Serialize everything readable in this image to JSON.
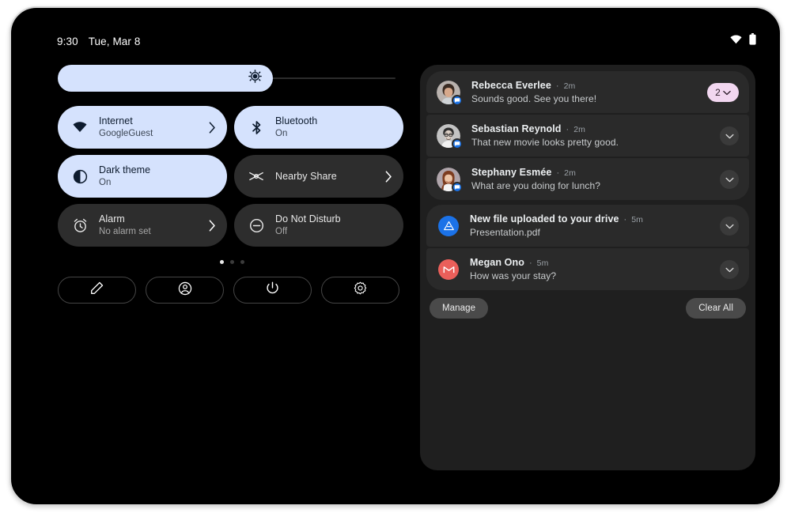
{
  "statusbar": {
    "time": "9:30",
    "date": "Tue, Mar 8",
    "icons": [
      "wifi-icon",
      "battery-icon"
    ]
  },
  "quick_settings": {
    "brightness": {
      "icon": "brightness-sun-icon",
      "level_percent": 62
    },
    "tiles": [
      {
        "title": "Internet",
        "subtitle": "GoogleGuest",
        "icon": "wifi-icon",
        "state": "on",
        "chevron": true
      },
      {
        "title": "Bluetooth",
        "subtitle": "On",
        "icon": "bluetooth-icon",
        "state": "on",
        "chevron": false
      },
      {
        "title": "Dark theme",
        "subtitle": "On",
        "icon": "dark-theme-icon",
        "state": "on",
        "chevron": false
      },
      {
        "title": "Nearby Share",
        "subtitle": "",
        "icon": "nearby-share-icon",
        "state": "off",
        "chevron": true
      },
      {
        "title": "Alarm",
        "subtitle": "No alarm set",
        "icon": "alarm-icon",
        "state": "off",
        "chevron": true
      },
      {
        "title": "Do Not Disturb",
        "subtitle": "Off",
        "icon": "do-not-disturb-icon",
        "state": "off",
        "chevron": false
      }
    ],
    "page_dots": {
      "total": 3,
      "active_index": 0
    },
    "action_buttons": [
      {
        "icon": "pencil-edit-icon"
      },
      {
        "icon": "user-account-icon"
      },
      {
        "icon": "power-icon"
      },
      {
        "icon": "settings-gear-icon"
      }
    ]
  },
  "notifications": {
    "items": [
      {
        "sender": "Rebecca Everlee",
        "separator": "·",
        "time": "2m",
        "message": "Sounds good. See you there!",
        "avatar_type": "photo",
        "app_badge": "messages-icon",
        "badge_count": "2",
        "expand_icon": "chevron-down-icon"
      },
      {
        "sender": "Sebastian Reynold",
        "separator": "·",
        "time": "2m",
        "message": "That new movie looks pretty good.",
        "avatar_type": "photo",
        "app_badge": "messages-icon",
        "badge_count": "",
        "expand_icon": "chevron-down-icon"
      },
      {
        "sender": "Stephany Esmée",
        "separator": "·",
        "time": "2m",
        "message": "What are you doing for lunch?",
        "avatar_type": "photo",
        "app_badge": "messages-icon",
        "badge_count": "",
        "expand_icon": "chevron-down-icon"
      },
      {
        "sender": "New file uploaded to your drive",
        "separator": "·",
        "time": "5m",
        "message": "Presentation.pdf",
        "avatar_type": "drive-icon",
        "app_badge": "",
        "badge_count": "",
        "expand_icon": "chevron-down-icon"
      },
      {
        "sender": "Megan Ono",
        "separator": "·",
        "time": "5m",
        "message": "How was your stay?",
        "avatar_type": "gmail-icon",
        "app_badge": "",
        "badge_count": "",
        "expand_icon": "chevron-down-icon"
      }
    ],
    "manage_label": "Manage",
    "clear_all_label": "Clear All"
  },
  "colors": {
    "tile_on": "#d5e2fd",
    "tile_off": "#2d2d2d",
    "shade_bg": "#1f1f1f",
    "notif_bg": "#2a2a2a",
    "badge_pink": "#f2d7f0",
    "accent_blue": "#1a73e8",
    "gmail_red": "#ea5f5a",
    "screen_bg": "#000000"
  }
}
